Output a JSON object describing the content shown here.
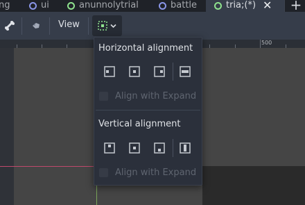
{
  "tabs": [
    {
      "label": "ng",
      "icon": "none",
      "active": false
    },
    {
      "label": "ui",
      "icon": "node-ring-blue-icon",
      "active": false
    },
    {
      "label": "anunnolytrial",
      "icon": "node-ring-green-icon",
      "active": false
    },
    {
      "label": "battle",
      "icon": "node-ring-blue-icon",
      "active": false
    },
    {
      "label": "tria;(*)",
      "icon": "node-ring-green-icon",
      "active": true
    }
  ],
  "toolbar": {
    "view_label": "View"
  },
  "ruler": {
    "label": "500"
  },
  "popup": {
    "horizontal_title": "Horizontal alignment",
    "vertical_title": "Vertical alignment",
    "align_expand_label": "Align with Expand"
  },
  "colors": {
    "accent": "#8fe38e",
    "scene_ring_blue": "#8a96e8",
    "guide_red": "#c04a6c",
    "guide_green": "#7aa55a"
  }
}
